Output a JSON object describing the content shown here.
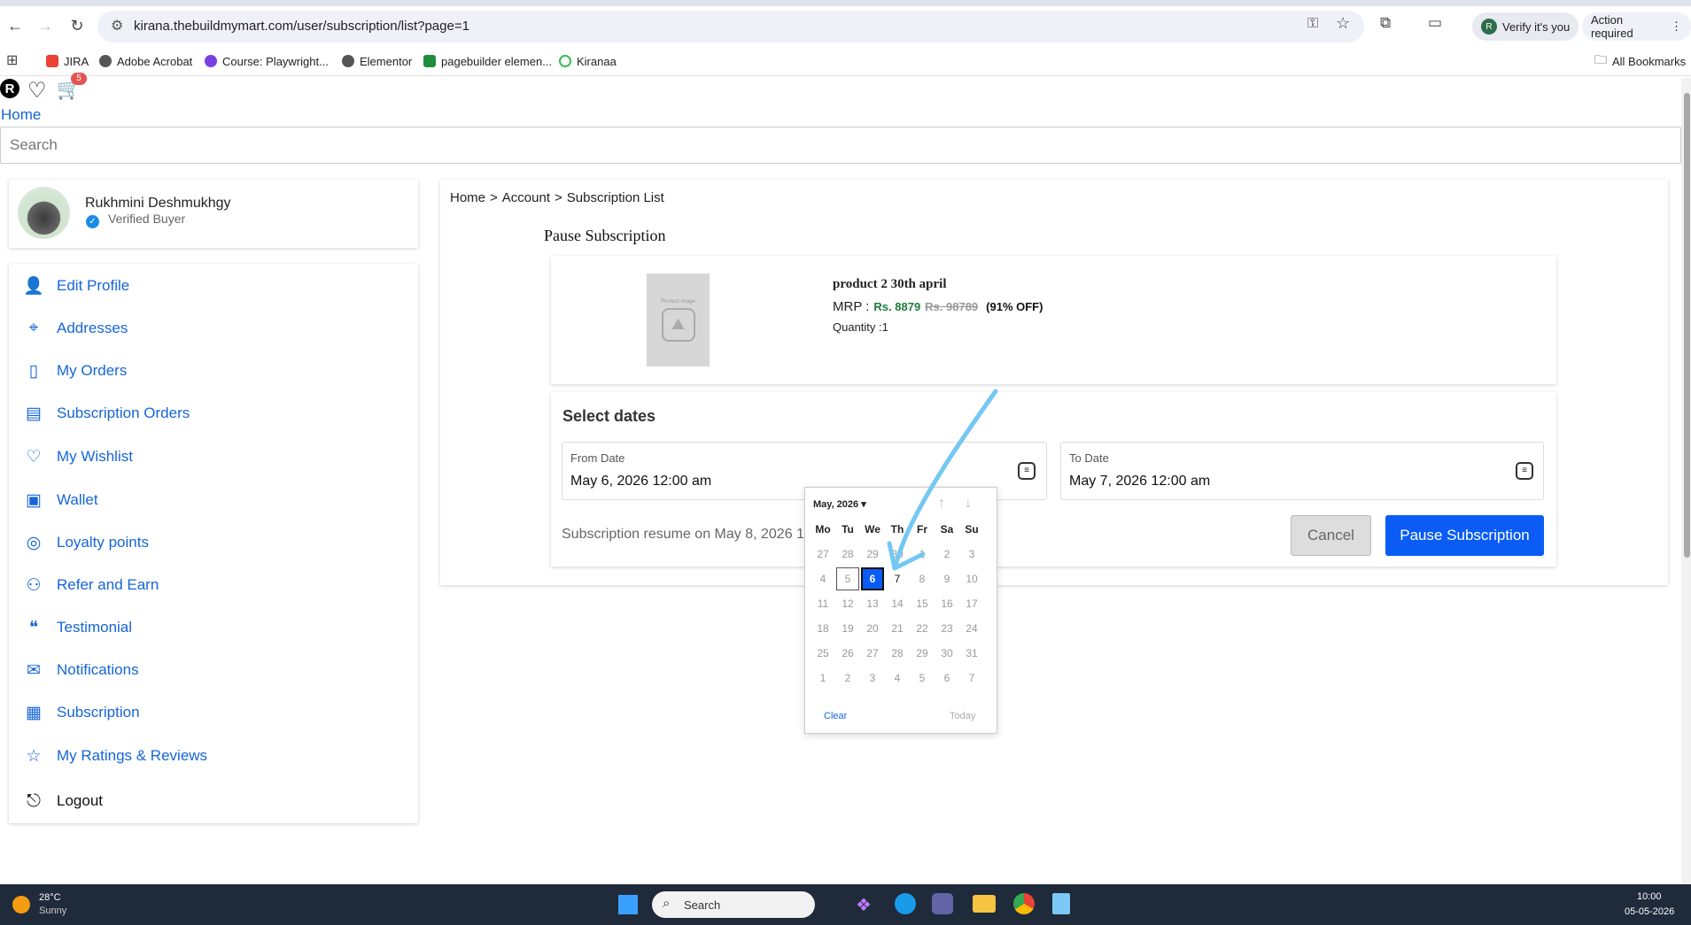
{
  "browser": {
    "url": "kirana.thebuildmymart.com/user/subscription/list?page=1",
    "verify_chip": "Verify it's you",
    "action_chip": "Action required",
    "bookmarks": [
      "JIRA",
      "Adobe Acrobat",
      "Course: Playwright...",
      "Elementor",
      "pagebuilder elemen...",
      "Kiranaa"
    ],
    "all_bookmarks": "All Bookmarks"
  },
  "header": {
    "avatar_letter": "R",
    "cart_count": "5",
    "home_link": "Home",
    "search_placeholder": "Search"
  },
  "profile": {
    "name": "Rukhmini Deshmukhgy",
    "status": "Verified Buyer"
  },
  "sidebar": {
    "items": [
      {
        "label": "Edit Profile",
        "icon": "user-icon"
      },
      {
        "label": "Addresses",
        "icon": "location-icon"
      },
      {
        "label": "My Orders",
        "icon": "orders-icon"
      },
      {
        "label": "Subscription Orders",
        "icon": "subscription-orders-icon"
      },
      {
        "label": "My Wishlist",
        "icon": "heart-icon"
      },
      {
        "label": "Wallet",
        "icon": "wallet-icon"
      },
      {
        "label": "Loyalty points",
        "icon": "coins-icon"
      },
      {
        "label": "Refer and Earn",
        "icon": "refer-icon"
      },
      {
        "label": "Testimonial",
        "icon": "quote-icon"
      },
      {
        "label": "Notifications",
        "icon": "notification-icon"
      },
      {
        "label": "Subscription",
        "icon": "subscription-icon"
      },
      {
        "label": "My Ratings & Reviews",
        "icon": "star-icon"
      }
    ],
    "logout": "Logout"
  },
  "breadcrumb": {
    "home": "Home",
    "sep1": ">",
    "account": "Account",
    "sep2": ">",
    "current": "Subscription List"
  },
  "pause": {
    "title": "Pause Subscription",
    "product": {
      "name": "product 2 30th april",
      "image_text": "Product image",
      "mrp_label": "MRP :",
      "price": "Rs. 8879",
      "original_price": "Rs. 98789",
      "discount": "(91% OFF)",
      "quantity": "Quantity :1"
    },
    "select_dates": "Select dates",
    "from_label": "From Date",
    "from_value": "May 6, 2026 12:00 am",
    "to_label": "To Date",
    "to_value": "May 7, 2026 12:00 am",
    "resume_text": "Subscription resume on May 8, 2026 1",
    "cancel": "Cancel",
    "submit": "Pause Subscription"
  },
  "datepicker": {
    "month": "May, 2026",
    "weekdays": [
      "Mo",
      "Tu",
      "We",
      "Th",
      "Fr",
      "Sa",
      "Su"
    ],
    "weeks": [
      [
        "27",
        "28",
        "29",
        "30",
        "1",
        "2",
        "3"
      ],
      [
        "4",
        "5",
        "6",
        "7",
        "8",
        "9",
        "10"
      ],
      [
        "11",
        "12",
        "13",
        "14",
        "15",
        "16",
        "17"
      ],
      [
        "18",
        "19",
        "20",
        "21",
        "22",
        "23",
        "24"
      ],
      [
        "25",
        "26",
        "27",
        "28",
        "29",
        "30",
        "31"
      ],
      [
        "1",
        "2",
        "3",
        "4",
        "5",
        "6",
        "7"
      ]
    ],
    "selected": "6",
    "today": "5",
    "enabled": [
      "6",
      "7"
    ],
    "clear": "Clear",
    "today_label": "Today"
  },
  "taskbar": {
    "temp": "28°C",
    "weather": "Sunny",
    "search": "Search",
    "time": "10:00",
    "date": "05-05-2026"
  },
  "colors": {
    "accent": "#0a5cf5",
    "link": "#1565d8",
    "price_green": "#1e7d3a",
    "annotation_arrow": "#74c8f2"
  }
}
